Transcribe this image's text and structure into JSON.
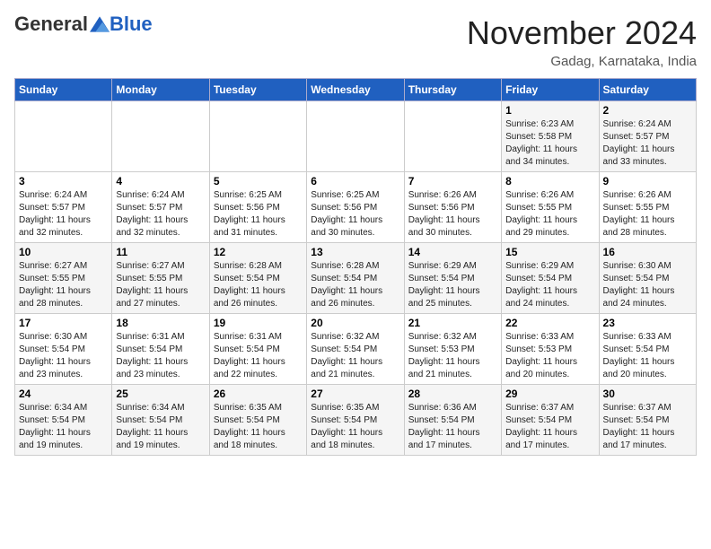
{
  "header": {
    "logo_general": "General",
    "logo_blue": "Blue",
    "month_title": "November 2024",
    "subtitle": "Gadag, Karnataka, India"
  },
  "weekdays": [
    "Sunday",
    "Monday",
    "Tuesday",
    "Wednesday",
    "Thursday",
    "Friday",
    "Saturday"
  ],
  "weeks": [
    [
      {
        "day": "",
        "info": ""
      },
      {
        "day": "",
        "info": ""
      },
      {
        "day": "",
        "info": ""
      },
      {
        "day": "",
        "info": ""
      },
      {
        "day": "",
        "info": ""
      },
      {
        "day": "1",
        "info": "Sunrise: 6:23 AM\nSunset: 5:58 PM\nDaylight: 11 hours\nand 34 minutes."
      },
      {
        "day": "2",
        "info": "Sunrise: 6:24 AM\nSunset: 5:57 PM\nDaylight: 11 hours\nand 33 minutes."
      }
    ],
    [
      {
        "day": "3",
        "info": "Sunrise: 6:24 AM\nSunset: 5:57 PM\nDaylight: 11 hours\nand 32 minutes."
      },
      {
        "day": "4",
        "info": "Sunrise: 6:24 AM\nSunset: 5:57 PM\nDaylight: 11 hours\nand 32 minutes."
      },
      {
        "day": "5",
        "info": "Sunrise: 6:25 AM\nSunset: 5:56 PM\nDaylight: 11 hours\nand 31 minutes."
      },
      {
        "day": "6",
        "info": "Sunrise: 6:25 AM\nSunset: 5:56 PM\nDaylight: 11 hours\nand 30 minutes."
      },
      {
        "day": "7",
        "info": "Sunrise: 6:26 AM\nSunset: 5:56 PM\nDaylight: 11 hours\nand 30 minutes."
      },
      {
        "day": "8",
        "info": "Sunrise: 6:26 AM\nSunset: 5:55 PM\nDaylight: 11 hours\nand 29 minutes."
      },
      {
        "day": "9",
        "info": "Sunrise: 6:26 AM\nSunset: 5:55 PM\nDaylight: 11 hours\nand 28 minutes."
      }
    ],
    [
      {
        "day": "10",
        "info": "Sunrise: 6:27 AM\nSunset: 5:55 PM\nDaylight: 11 hours\nand 28 minutes."
      },
      {
        "day": "11",
        "info": "Sunrise: 6:27 AM\nSunset: 5:55 PM\nDaylight: 11 hours\nand 27 minutes."
      },
      {
        "day": "12",
        "info": "Sunrise: 6:28 AM\nSunset: 5:54 PM\nDaylight: 11 hours\nand 26 minutes."
      },
      {
        "day": "13",
        "info": "Sunrise: 6:28 AM\nSunset: 5:54 PM\nDaylight: 11 hours\nand 26 minutes."
      },
      {
        "day": "14",
        "info": "Sunrise: 6:29 AM\nSunset: 5:54 PM\nDaylight: 11 hours\nand 25 minutes."
      },
      {
        "day": "15",
        "info": "Sunrise: 6:29 AM\nSunset: 5:54 PM\nDaylight: 11 hours\nand 24 minutes."
      },
      {
        "day": "16",
        "info": "Sunrise: 6:30 AM\nSunset: 5:54 PM\nDaylight: 11 hours\nand 24 minutes."
      }
    ],
    [
      {
        "day": "17",
        "info": "Sunrise: 6:30 AM\nSunset: 5:54 PM\nDaylight: 11 hours\nand 23 minutes."
      },
      {
        "day": "18",
        "info": "Sunrise: 6:31 AM\nSunset: 5:54 PM\nDaylight: 11 hours\nand 23 minutes."
      },
      {
        "day": "19",
        "info": "Sunrise: 6:31 AM\nSunset: 5:54 PM\nDaylight: 11 hours\nand 22 minutes."
      },
      {
        "day": "20",
        "info": "Sunrise: 6:32 AM\nSunset: 5:54 PM\nDaylight: 11 hours\nand 21 minutes."
      },
      {
        "day": "21",
        "info": "Sunrise: 6:32 AM\nSunset: 5:53 PM\nDaylight: 11 hours\nand 21 minutes."
      },
      {
        "day": "22",
        "info": "Sunrise: 6:33 AM\nSunset: 5:53 PM\nDaylight: 11 hours\nand 20 minutes."
      },
      {
        "day": "23",
        "info": "Sunrise: 6:33 AM\nSunset: 5:54 PM\nDaylight: 11 hours\nand 20 minutes."
      }
    ],
    [
      {
        "day": "24",
        "info": "Sunrise: 6:34 AM\nSunset: 5:54 PM\nDaylight: 11 hours\nand 19 minutes."
      },
      {
        "day": "25",
        "info": "Sunrise: 6:34 AM\nSunset: 5:54 PM\nDaylight: 11 hours\nand 19 minutes."
      },
      {
        "day": "26",
        "info": "Sunrise: 6:35 AM\nSunset: 5:54 PM\nDaylight: 11 hours\nand 18 minutes."
      },
      {
        "day": "27",
        "info": "Sunrise: 6:35 AM\nSunset: 5:54 PM\nDaylight: 11 hours\nand 18 minutes."
      },
      {
        "day": "28",
        "info": "Sunrise: 6:36 AM\nSunset: 5:54 PM\nDaylight: 11 hours\nand 17 minutes."
      },
      {
        "day": "29",
        "info": "Sunrise: 6:37 AM\nSunset: 5:54 PM\nDaylight: 11 hours\nand 17 minutes."
      },
      {
        "day": "30",
        "info": "Sunrise: 6:37 AM\nSunset: 5:54 PM\nDaylight: 11 hours\nand 17 minutes."
      }
    ]
  ]
}
